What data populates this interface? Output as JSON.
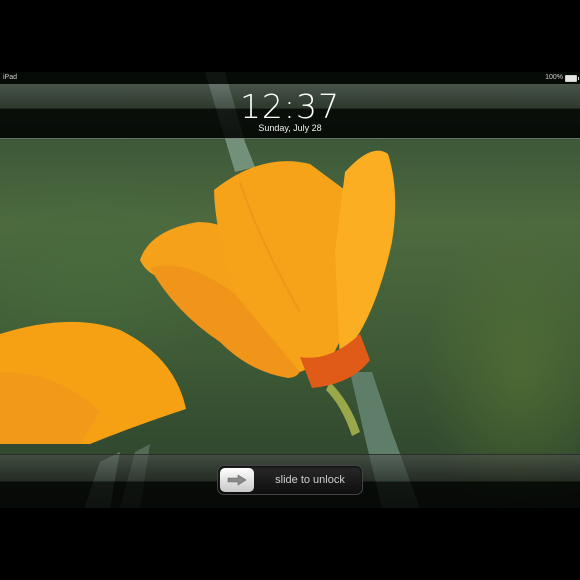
{
  "status_bar": {
    "device_name": "iPad",
    "battery_text": "100%"
  },
  "lock_screen": {
    "time": "12:37",
    "date": "Sunday, July 28"
  },
  "unlock_slider": {
    "label": "slide to unlock",
    "icon": "arrow-right-icon"
  },
  "colors": {
    "petal_orange": "#f2a21b",
    "stem_green": "#6f8f6a"
  }
}
